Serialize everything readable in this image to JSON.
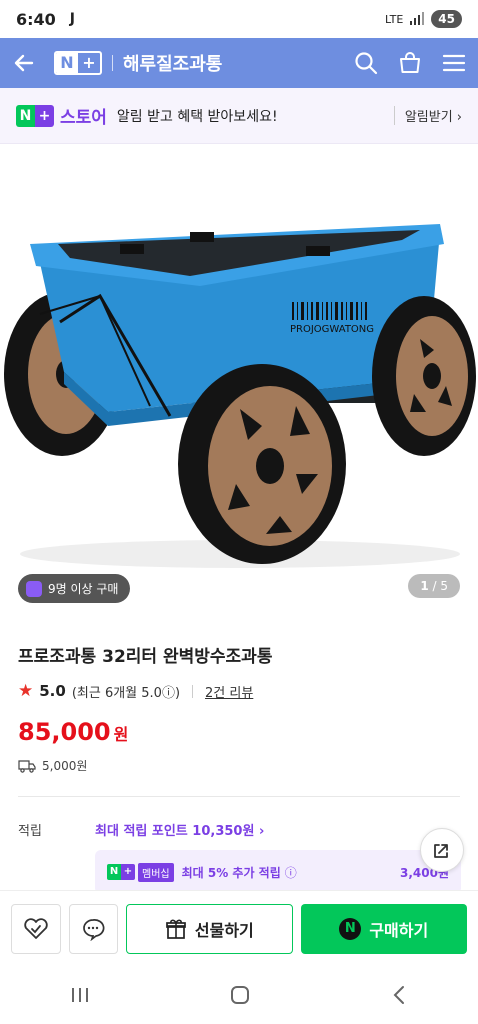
{
  "status_bar": {
    "time": "6:40",
    "indicator": "J",
    "network": "LTE",
    "battery": "45"
  },
  "top_bar": {
    "title": "해루질조과통",
    "n_letter": "N",
    "plus": "+"
  },
  "banner": {
    "n_letter": "N",
    "plus": "+",
    "store": "스토어",
    "message": "알림 받고 혜택 받아보세요!",
    "alarm": "알림받기 ›"
  },
  "hero": {
    "buy_count": "9명 이상 구매",
    "page_current": "1",
    "page_total": "/ 5",
    "label_text": "PROJOGWATONG"
  },
  "product": {
    "name": "프로조과통 32리터 완벽방수조과통",
    "rating_star": "★",
    "rating": "5.0",
    "rating_detail": "(최근 6개월 5.0ⓘ)",
    "reviews": "2건 리뷰",
    "price": "85,000",
    "price_unit": "원",
    "shipping": "5,000원"
  },
  "points": {
    "label": "적립",
    "link": "최대 적립 포인트 10,350원 ›",
    "member_badge": "멤버십",
    "member_n": "N",
    "member_plus": "+",
    "member_text": "최대 5% 추가 적립",
    "member_info": "ⓘ",
    "member_amount": "3,400원"
  },
  "actions": {
    "gift": "선물하기",
    "buy": "구매하기",
    "buy_n": "N"
  },
  "colors": {
    "brand": "#6e8ee0",
    "naver_green": "#03c75a",
    "purple": "#7b3fe4",
    "price_red": "#e5101b"
  }
}
